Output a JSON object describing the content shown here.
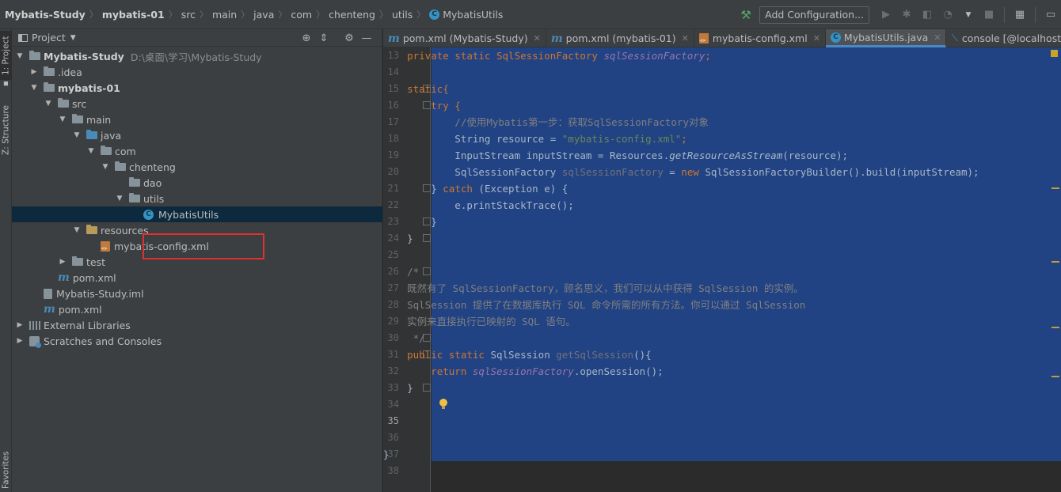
{
  "breadcrumb": {
    "items": [
      "Mybatis-Study",
      "mybatis-01",
      "src",
      "main",
      "java",
      "com",
      "chenteng",
      "utils",
      "MybatisUtils"
    ]
  },
  "toolbar": {
    "add_configuration": "Add Configuration..."
  },
  "left_strip": {
    "project_tab": "1: Project",
    "structure_tab": "Z: Structure",
    "favorites_tab": "Favorites"
  },
  "project_panel": {
    "title": "Project",
    "tree": [
      {
        "label": "Mybatis-Study",
        "path": "D:\\桌面\\学习\\Mybatis-Study",
        "icon": "module-folder-icon",
        "bold": true
      },
      {
        "label": ".idea",
        "icon": "folder-icon"
      },
      {
        "label": "mybatis-01",
        "icon": "module-folder-icon",
        "bold": true
      },
      {
        "label": "src",
        "icon": "folder-icon"
      },
      {
        "label": "main",
        "icon": "folder-icon"
      },
      {
        "label": "java",
        "icon": "source-folder-icon"
      },
      {
        "label": "com",
        "icon": "package-icon"
      },
      {
        "label": "chenteng",
        "icon": "package-icon"
      },
      {
        "label": "dao",
        "icon": "package-icon"
      },
      {
        "label": "utils",
        "icon": "package-icon"
      },
      {
        "label": "MybatisUtils",
        "icon": "java-class-icon",
        "selected": true
      },
      {
        "label": "resources",
        "icon": "resources-folder-icon"
      },
      {
        "label": "mybatis-config.xml",
        "icon": "xml-file-icon"
      },
      {
        "label": "test",
        "icon": "folder-icon"
      },
      {
        "label": "pom.xml",
        "icon": "maven-icon"
      },
      {
        "label": "Mybatis-Study.iml",
        "icon": "iml-file-icon"
      },
      {
        "label": "pom.xml",
        "icon": "maven-icon"
      },
      {
        "label": "External Libraries",
        "icon": "library-icon"
      },
      {
        "label": "Scratches and Consoles",
        "icon": "scratch-icon"
      }
    ]
  },
  "tabs": [
    {
      "label": "pom.xml (Mybatis-Study)",
      "icon": "maven-icon"
    },
    {
      "label": "pom.xml (mybatis-01)",
      "icon": "maven-icon"
    },
    {
      "label": "mybatis-config.xml",
      "icon": "xml-file-icon"
    },
    {
      "label": "MybatisUtils.java",
      "icon": "java-class-icon",
      "active": true
    },
    {
      "label": "console [@localhost]",
      "icon": "console-icon"
    }
  ],
  "editor": {
    "line_numbers": [
      "13",
      "14",
      "15",
      "16",
      "17",
      "18",
      "19",
      "20",
      "21",
      "22",
      "23",
      "24",
      "25",
      "26",
      "27",
      "28",
      "29",
      "30",
      "31",
      "32",
      "33",
      "34",
      "35",
      "36",
      "37",
      "38"
    ],
    "current_line": "35",
    "code": {
      "l13_a": "    private static SqlSessionFactory ",
      "l13_b": "sqlSessionFactory",
      "l13_c": ";",
      "l15": "    static{",
      "l16": "        try {",
      "l17": "            //使用Mybatis第一步：获取SqlSessionFactory对象",
      "l18_a": "            String resource = ",
      "l18_b": "\"mybatis-config.xml\"",
      "l18_c": ";",
      "l19_a": "            InputStream inputStream = Resources.",
      "l19_b": "getResourceAsStream",
      "l19_c": "(resource);",
      "l20_a": "            SqlSessionFactory ",
      "l20_b": "sqlSessionFactory",
      "l20_c": " = ",
      "l20_d": "new",
      "l20_e": " SqlSessionFactoryBuilder().build(inputStream);",
      "l21_a": "        } ",
      "l21_b": "catch",
      "l21_c": " (Exception e) {",
      "l22": "            e.printStackTrace();",
      "l23": "        }",
      "l24": "    }",
      "l26": "    /*",
      "l27": "    既然有了 SqlSessionFactory，顾名思义，我们可以从中获得 SqlSession 的实例。",
      "l28": "    SqlSession 提供了在数据库执行 SQL 命令所需的所有方法。你可以通过 SqlSession",
      "l29": "    实例来直接执行已映射的 SQL 语句。",
      "l30": "     */",
      "l31_a": "    public static",
      "l31_b": " SqlSession ",
      "l31_c": "getSqlSession",
      "l31_d": "(){",
      "l32_a": "        return ",
      "l32_b": "sqlSessionFactory",
      "l32_c": ".openSession();",
      "l33": "    }",
      "l37": "}"
    }
  },
  "colors": {
    "selection": "#214283",
    "keyword": "#cc7832",
    "field": "#9876aa",
    "string": "#6a8759",
    "comment": "#808080",
    "highlight_box": "#e03030"
  }
}
